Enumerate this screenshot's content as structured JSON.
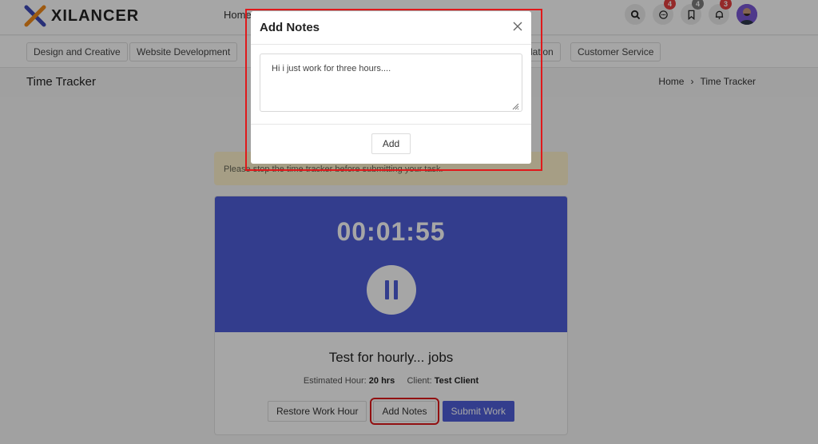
{
  "header": {
    "brand": "XILANCER",
    "nav_home": "Home",
    "icons": [
      {
        "name": "search-icon",
        "badge": ""
      },
      {
        "name": "chat-icon",
        "badge": "4"
      },
      {
        "name": "bookmark-icon",
        "badge": "4"
      },
      {
        "name": "bell-icon",
        "badge": "3"
      }
    ]
  },
  "categories": [
    "Design and Creative",
    "Website Development",
    "slation",
    "Customer Service"
  ],
  "page": {
    "title": "Time Tracker",
    "breadcrumb": [
      "Home",
      "Time Tracker"
    ]
  },
  "alert": "Please stop the time tracker before submitting your task.",
  "tracker": {
    "timer": "00:01:55",
    "job_title": "Test for hourly... jobs",
    "estimated_label": "Estimated Hour:",
    "estimated_value": "20 hrs",
    "client_label": "Client:",
    "client_value": "Test Client",
    "buttons": {
      "restore": "Restore Work Hour",
      "notes": "Add Notes",
      "submit": "Submit Work"
    }
  },
  "modal": {
    "title": "Add Notes",
    "notes_value": "Hi i just work for three hours....",
    "add_label": "Add"
  },
  "colors": {
    "accent": "#4f5fd9",
    "highlight": "#e0191b",
    "badge_red": "#e43f3f",
    "alert_bg": "#fff3cd"
  }
}
